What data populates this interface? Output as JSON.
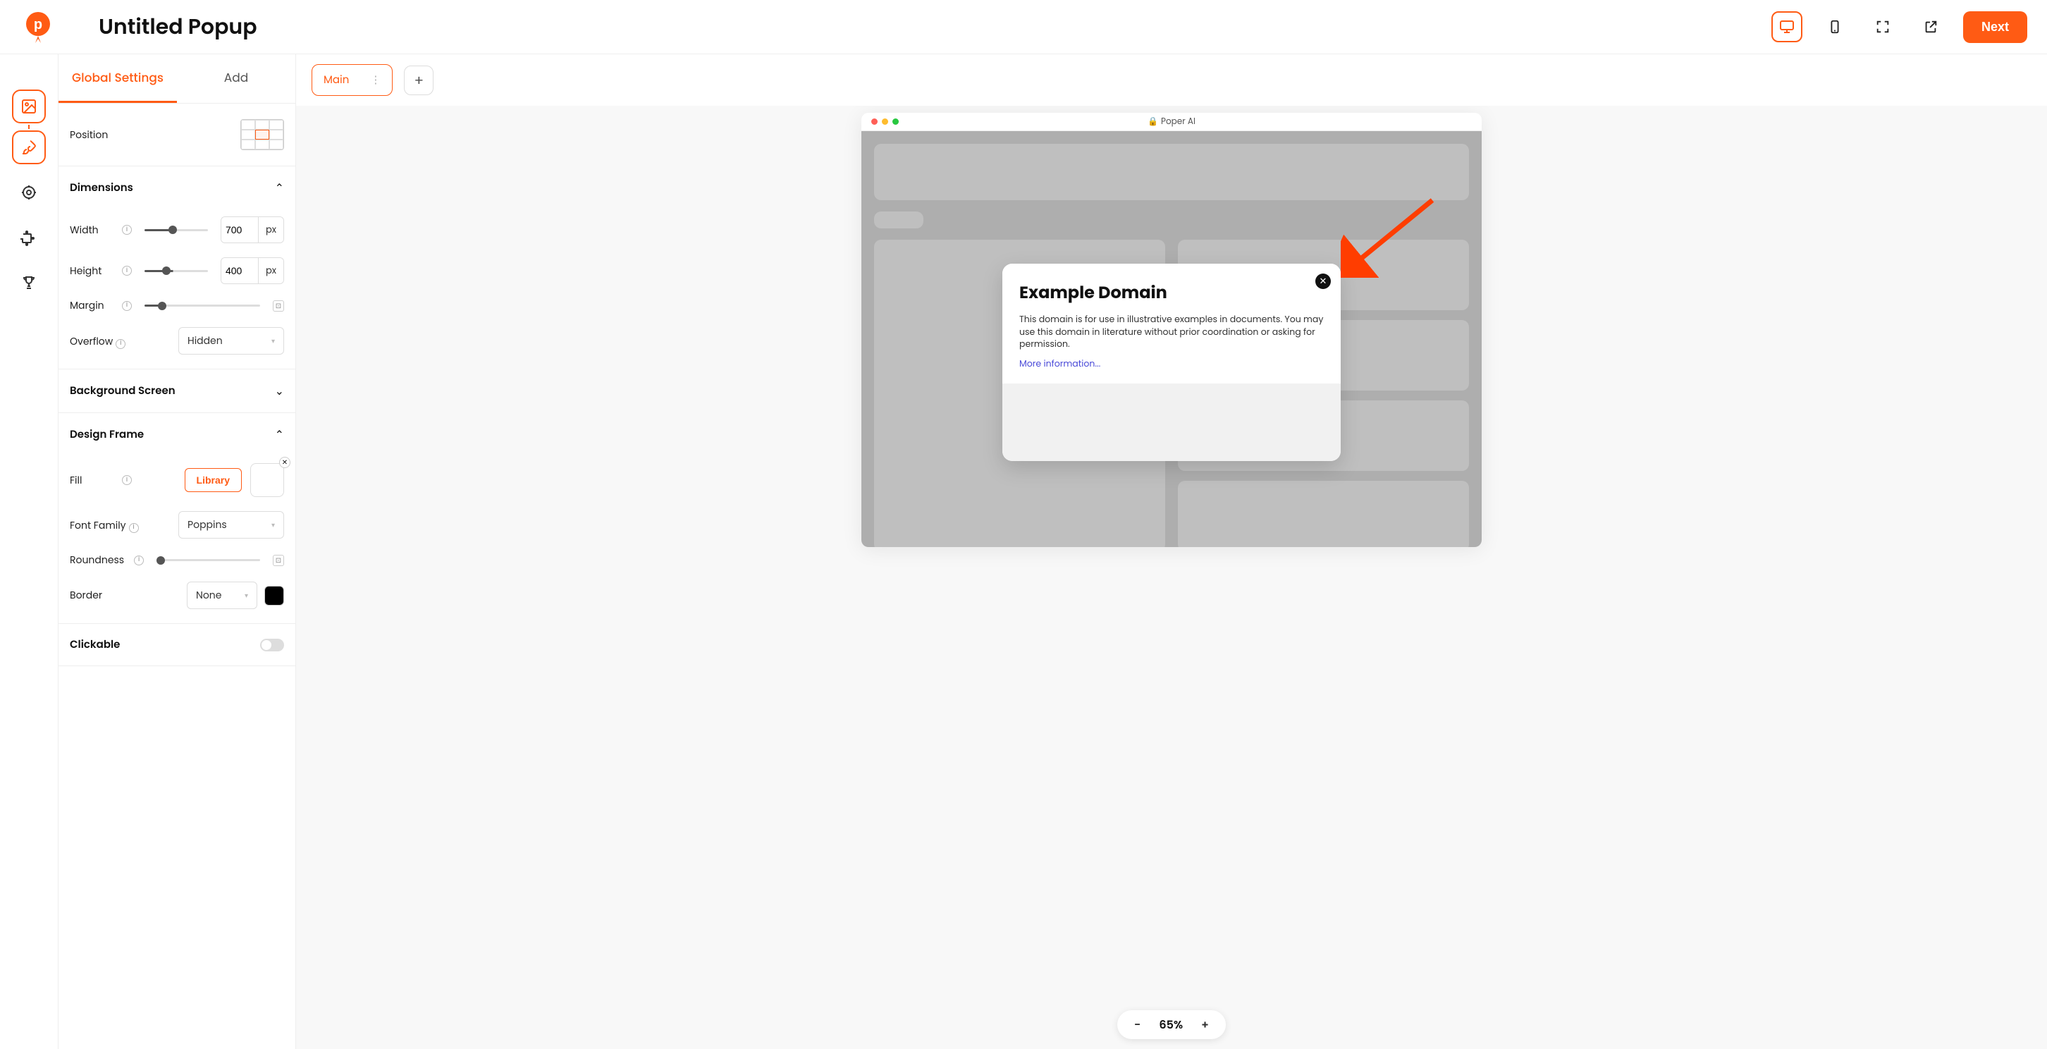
{
  "header": {
    "title": "Untitled Popup",
    "next_label": "Next"
  },
  "sidebar_tabs": {
    "global": "Global Settings",
    "add": "Add"
  },
  "position": {
    "title": "Position"
  },
  "dimensions": {
    "title": "Dimensions",
    "width_label": "Width",
    "width_value": "700",
    "width_unit": "px",
    "height_label": "Height",
    "height_value": "400",
    "height_unit": "px",
    "margin_label": "Margin",
    "overflow_label": "Overflow",
    "overflow_value": "Hidden"
  },
  "bg_screen": {
    "title": "Background Screen"
  },
  "design": {
    "title": "Design Frame",
    "fill_label": "Fill",
    "library_label": "Library",
    "font_label": "Font Family",
    "font_value": "Poppins",
    "roundness_label": "Roundness",
    "border_label": "Border",
    "border_value": "None"
  },
  "clickable": {
    "title": "Clickable"
  },
  "steps": {
    "main": "Main",
    "add": "+"
  },
  "browser": {
    "site": "Poper AI"
  },
  "popup": {
    "title": "Example Domain",
    "body": "This domain is for use in illustrative examples in documents. You may use this domain in literature without prior coordination or asking for permission.",
    "link": "More information..."
  },
  "zoom": {
    "minus": "-",
    "value": "65%",
    "plus": "+"
  }
}
